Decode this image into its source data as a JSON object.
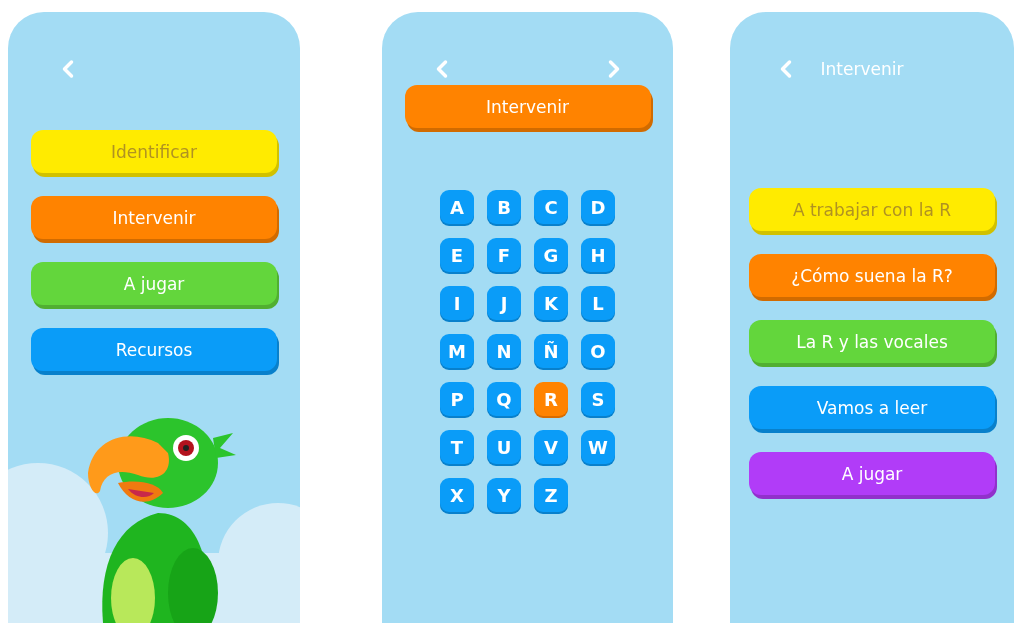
{
  "screens": [
    {
      "kind": "menu",
      "nav": {
        "back": true,
        "forward": false
      },
      "buttons": [
        {
          "label": "Identificar",
          "color": "#ffeb00"
        },
        {
          "label": "Intervenir",
          "color": "#ff8300"
        },
        {
          "label": "A jugar",
          "color": "#63d63c"
        },
        {
          "label": "Recursos",
          "color": "#0a9cf8"
        }
      ]
    },
    {
      "kind": "alphabet",
      "nav": {
        "back": true,
        "forward": true
      },
      "title_button": {
        "label": "Intervenir",
        "color": "#ff8300"
      },
      "letters": [
        {
          "label": "A",
          "selected": false
        },
        {
          "label": "B",
          "selected": false
        },
        {
          "label": "C",
          "selected": false
        },
        {
          "label": "D",
          "selected": false
        },
        {
          "label": "E",
          "selected": false
        },
        {
          "label": "F",
          "selected": false
        },
        {
          "label": "G",
          "selected": false
        },
        {
          "label": "H",
          "selected": false
        },
        {
          "label": "I",
          "selected": false
        },
        {
          "label": "J",
          "selected": false
        },
        {
          "label": "K",
          "selected": false
        },
        {
          "label": "L",
          "selected": false
        },
        {
          "label": "M",
          "selected": false
        },
        {
          "label": "N",
          "selected": false
        },
        {
          "label": "Ñ",
          "selected": false
        },
        {
          "label": "O",
          "selected": false
        },
        {
          "label": "P",
          "selected": false
        },
        {
          "label": "Q",
          "selected": false
        },
        {
          "label": "R",
          "selected": true
        },
        {
          "label": "S",
          "selected": false
        },
        {
          "label": "T",
          "selected": false
        },
        {
          "label": "U",
          "selected": false
        },
        {
          "label": "V",
          "selected": false
        },
        {
          "label": "W",
          "selected": false
        },
        {
          "label": "X",
          "selected": false
        },
        {
          "label": "Y",
          "selected": false
        },
        {
          "label": "Z",
          "selected": false
        }
      ]
    },
    {
      "kind": "submenu",
      "nav": {
        "back": true,
        "forward": false
      },
      "title": "Intervenir",
      "buttons": [
        {
          "label": "A trabajar con la R",
          "color": "#ffeb00"
        },
        {
          "label": "¿Cómo suena la R?",
          "color": "#ff8300"
        },
        {
          "label": "La R y las vocales",
          "color": "#63d63c"
        },
        {
          "label": "Vamos a leer",
          "color": "#0a9cf8"
        },
        {
          "label": "A jugar",
          "color": "#b13cf8"
        }
      ]
    }
  ]
}
